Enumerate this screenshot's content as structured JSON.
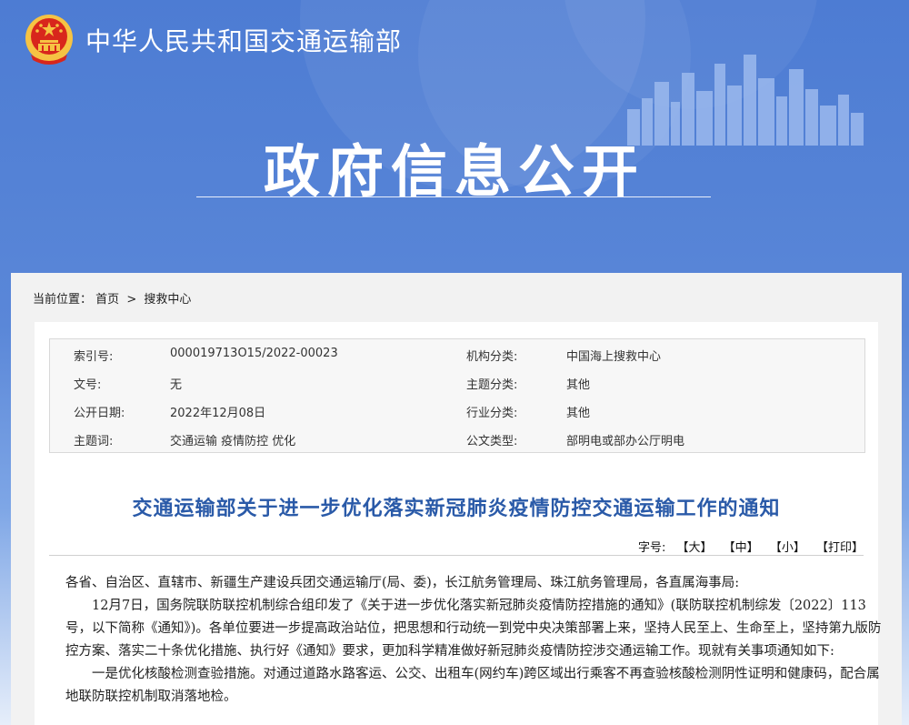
{
  "header": {
    "site_title": "中华人民共和国交通运输部",
    "section_title": "政府信息公开"
  },
  "breadcrumb": {
    "label": "当前位置：",
    "items": [
      "首页",
      "搜救中心"
    ],
    "separator": ">"
  },
  "meta": [
    {
      "k1": "索引号:",
      "v1": "000019713O15/2022-00023",
      "k2": "机构分类:",
      "v2": "中国海上搜救中心"
    },
    {
      "k1": "文号:",
      "v1": "无",
      "k2": "主题分类:",
      "v2": "其他"
    },
    {
      "k1": "公开日期:",
      "v1": "2022年12月08日",
      "k2": "行业分类:",
      "v2": "其他"
    },
    {
      "k1": "主题词:",
      "v1": "交通运输 疫情防控 优化",
      "k2": "公文类型:",
      "v2": "部明电或部办公厅明电"
    }
  ],
  "document": {
    "title": "交通运输部关于进一步优化落实新冠肺炎疫情防控交通运输工作的通知",
    "font_tools": {
      "label": "字号:",
      "large": "【大】",
      "medium": "【中】",
      "small": "【小】",
      "print": "【打印】"
    },
    "paragraphs": [
      "各省、自治区、直辖市、新疆生产建设兵团交通运输厅(局、委)，长江航务管理局、珠江航务管理局，各直属海事局:",
      "12月7日，国务院联防联控机制综合组印发了《关于进一步优化落实新冠肺炎疫情防控措施的通知》(联防联控机制综发〔2022〕113号，以下简称《通知》)。各单位要进一步提高政治站位，把思想和行动统一到党中央决策部署上来，坚持人民至上、生命至上，坚持第九版防控方案、落实二十条优化措施、执行好《通知》要求，更加科学精准做好新冠肺炎疫情防控涉交通运输工作。现就有关事项通知如下:",
      "一是优化核酸检测查验措施。对通过道路水路客运、公交、出租车(网约车)跨区域出行乘客不再查验核酸检测阴性证明和健康码，配合属地联防联控机制取消落地检。"
    ]
  },
  "colors": {
    "banner_blue": "#4d7cd3",
    "title_blue": "#2a5aa8",
    "emblem_red": "#d8261c",
    "emblem_gold": "#f6c343"
  }
}
